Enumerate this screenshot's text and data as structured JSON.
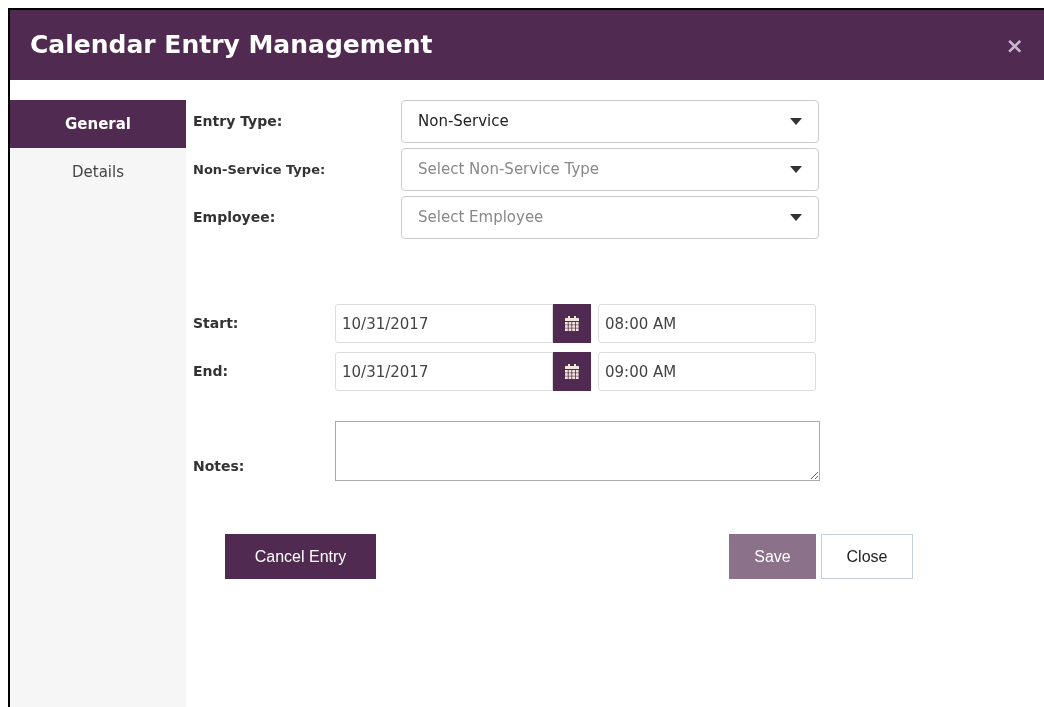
{
  "window": {
    "title": "Calendar Entry Management",
    "close": "×"
  },
  "tabs": [
    {
      "label": "General",
      "selected": true
    },
    {
      "label": "Details",
      "selected": false
    }
  ],
  "selects": [
    {
      "label": "Entry Type:",
      "value": "Non-Service",
      "small_label": false
    },
    {
      "label": "Non-Service Type:",
      "placeholder": "Select Non-Service Type",
      "small_label": true
    },
    {
      "label": "Employee:",
      "placeholder": "Select Employee",
      "small_label": false
    }
  ],
  "times": [
    {
      "label": "Start:",
      "date": "10/31/2017",
      "time": "08:00 AM"
    },
    {
      "label": "End:",
      "date": "10/31/2017",
      "time": "09:00 AM"
    }
  ],
  "notes": {
    "label": "Notes:"
  },
  "buttons": {
    "cancel": {
      "label": "Cancel Entry"
    },
    "save": {
      "label": "Save",
      "disabled": true
    },
    "close": {
      "label": "Close"
    }
  }
}
